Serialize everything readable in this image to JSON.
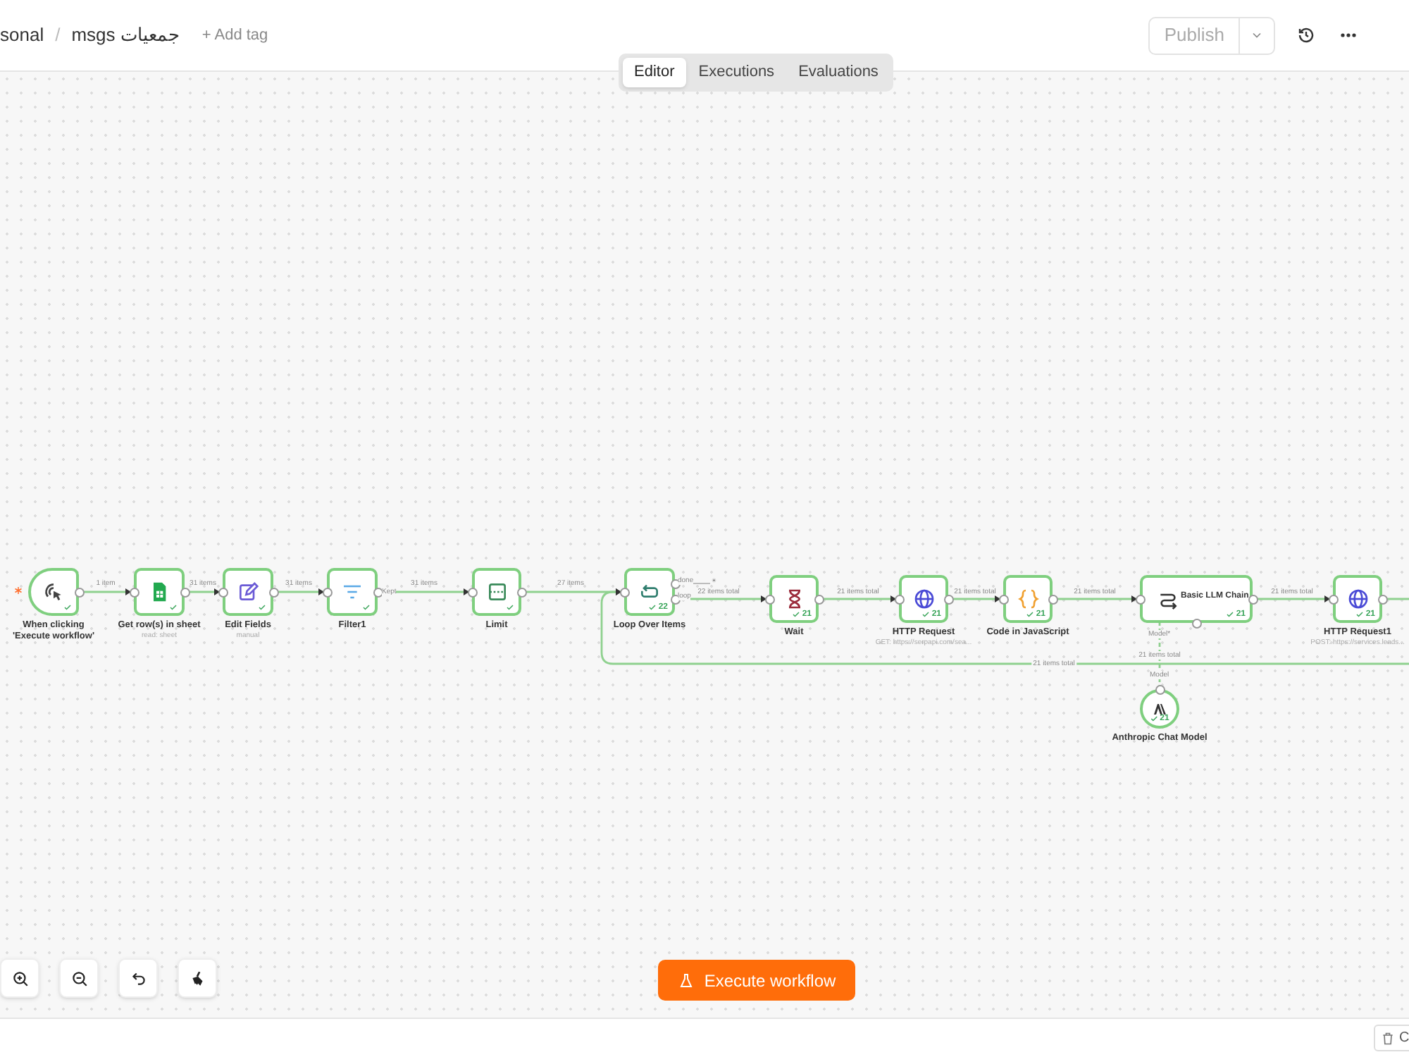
{
  "breadcrumb": {
    "parent": "sonal",
    "separator": "/",
    "workflow": "msgs جمعيات"
  },
  "add_tag": "+ Add tag",
  "publish": "Publish",
  "tabs": [
    {
      "label": "Editor",
      "selected": true
    },
    {
      "label": "Executions",
      "selected": false
    },
    {
      "label": "Evaluations",
      "selected": false
    }
  ],
  "nodes": [
    {
      "kind": "trigger",
      "label": "When clicking 'Execute workflow'",
      "success": true
    },
    {
      "kind": "sheets",
      "label": "Get row(s) in sheet",
      "subtitle": "read: sheet",
      "success": true
    },
    {
      "kind": "edit",
      "label": "Edit Fields",
      "subtitle": "manual",
      "success": true
    },
    {
      "kind": "filter",
      "label": "Filter1",
      "success": true
    },
    {
      "kind": "limit",
      "label": "Limit",
      "success": true
    },
    {
      "kind": "loop",
      "label": "Loop Over Items",
      "count": "22",
      "success": true
    },
    {
      "kind": "wait",
      "label": "Wait",
      "count": "21",
      "success": true
    },
    {
      "kind": "http",
      "label": "HTTP Request",
      "subtitle": "GET: https://serpapi.com/sea...",
      "count": "21",
      "success": true
    },
    {
      "kind": "code",
      "label": "Code in JavaScript",
      "count": "21",
      "success": true
    },
    {
      "kind": "chain",
      "label": "Basic LLM Chain",
      "count": "21",
      "success": true
    },
    {
      "kind": "http",
      "label": "HTTP Request1",
      "subtitle": "POST: https://services.leads...",
      "count": "21",
      "success": true
    },
    {
      "kind": "model",
      "label": "Anthropic Chat Model",
      "count": "21",
      "success": true
    }
  ],
  "edges": [
    {
      "label": "1 item"
    },
    {
      "label": "31 items"
    },
    {
      "label": "31 items"
    },
    {
      "label": "31 items"
    },
    {
      "label": "27 items"
    },
    {
      "label": "22 items total"
    },
    {
      "label": "21 items total"
    },
    {
      "label": "21 items total"
    },
    {
      "label": "21 items total"
    },
    {
      "label": "21 items total"
    },
    {
      "label": "21 items total"
    },
    {
      "label": "21 items total"
    }
  ],
  "filter_output": "Kept",
  "loop_outputs": [
    "done",
    "loop"
  ],
  "model_ports": {
    "input": "Model*",
    "output": "Model"
  },
  "execute_button": "Execute workflow",
  "bottom_bar_button": "C"
}
